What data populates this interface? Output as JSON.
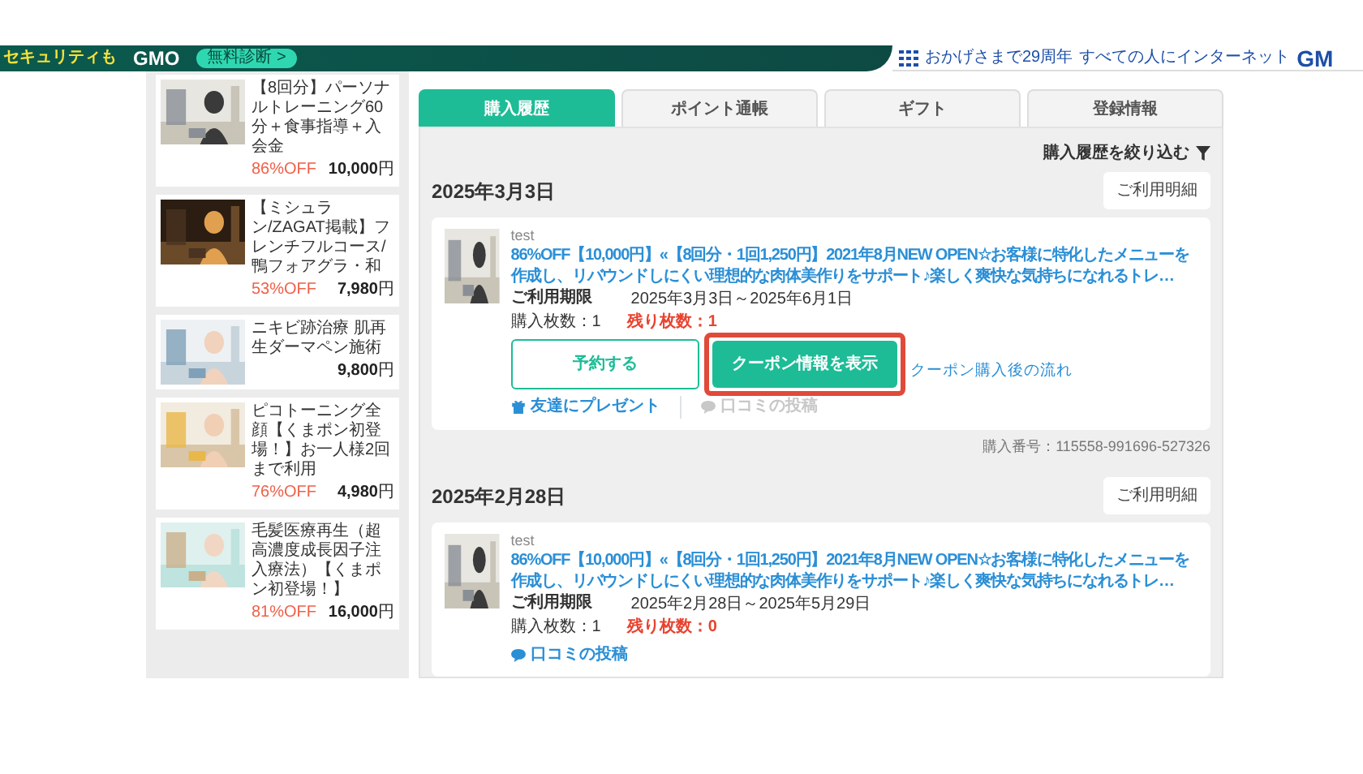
{
  "banner": {
    "tagline": "セキュリティも",
    "brand": "GMO",
    "cta": "無料診断 >",
    "anniversary": "おかげさまで29周年",
    "slogan": "すべての人にインターネット",
    "logo": "GM"
  },
  "sidebar": {
    "items": [
      {
        "title": "【8回分】パーソナルトレーニング60分＋食事指導＋入会金",
        "discount": "86%OFF",
        "price": "10,000",
        "unit": "円"
      },
      {
        "title": "【ミシュラン/ZAGAT掲載】フレンチフルコース/鴨フォアグラ・和",
        "discount": "53%OFF",
        "price": "7,980",
        "unit": "円"
      },
      {
        "title": "ニキビ跡治療 肌再生ダーマペン施術",
        "price": "9,800",
        "unit": "円"
      },
      {
        "title": "ピコトーニング全顔【くまポン初登場！】お一人様2回まで利用",
        "discount": "76%OFF",
        "price": "4,980",
        "unit": "円"
      },
      {
        "title": "毛髪医療再生（超高濃度成長因子注入療法）【くまポン初登場！】",
        "discount": "81%OFF",
        "price": "16,000",
        "unit": "円"
      }
    ]
  },
  "tabs": [
    {
      "label": "購入履歴",
      "selected": true
    },
    {
      "label": "ポイント通帳",
      "selected": false
    },
    {
      "label": "ギフト",
      "selected": false
    },
    {
      "label": "登録情報",
      "selected": false
    }
  ],
  "filter_link": "購入履歴を絞り込む",
  "orders": [
    {
      "date": "2025年3月3日",
      "details_button": "ご利用明細",
      "shop": "test",
      "title": "86%OFF【10,000円】«【8回分・1回1,250円】2021年8月NEW OPEN☆お客様に特化したメニューを作成し、リバウンドしにくい理想的な肉体美作りをサポート♪楽しく爽快な気持ちになれるトレ…",
      "period_label": "ご利用期限",
      "period": "2025年3月3日～2025年6月1日",
      "purchased": "購入枚数：1",
      "remaining": "残り枚数：1",
      "reserve_button": "予約する",
      "coupon_button": {
        "label": "クーポン情報を表示",
        "highlighted": true
      },
      "flow_link": "クーポン購入後の流れ",
      "gift_link": "友達にプレゼント",
      "review_link": {
        "label": "口コミの投稿",
        "disabled": true
      },
      "order_number": "購入番号：115558-991696-527326"
    },
    {
      "date": "2025年2月28日",
      "details_button": "ご利用明細",
      "shop": "test",
      "title": "86%OFF【10,000円】«【8回分・1回1,250円】2021年8月NEW OPEN☆お客様に特化したメニューを作成し、リバウンドしにくい理想的な肉体美作りをサポート♪楽しく爽快な気持ちになれるトレ…",
      "period_label": "ご利用期限",
      "period": "2025年2月28日～2025年5月29日",
      "purchased": "購入枚数：1",
      "remaining": "残り枚数：0",
      "review_link": {
        "label": "口コミの投稿",
        "disabled": false
      }
    }
  ]
}
